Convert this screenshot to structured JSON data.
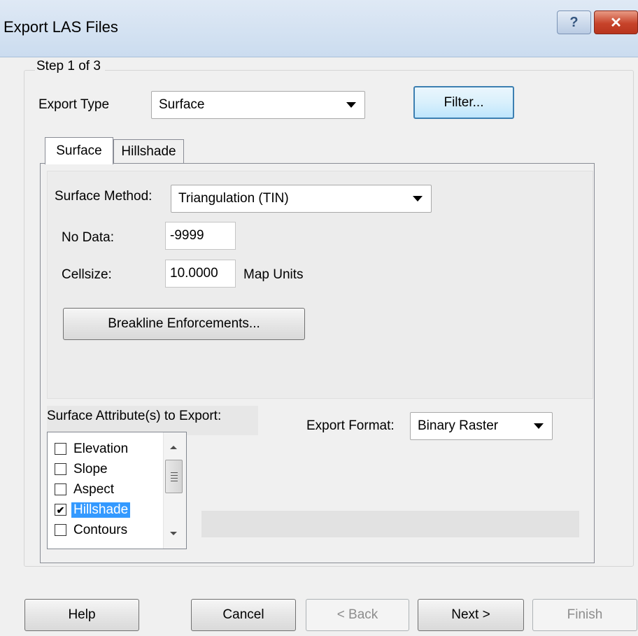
{
  "window": {
    "title": "Export LAS Files",
    "help_glyph": "?",
    "close_glyph": "✕"
  },
  "group": {
    "legend": "Step 1 of 3"
  },
  "export_type": {
    "label": "Export Type",
    "value": "Surface",
    "filter_button": "Filter..."
  },
  "tabs": [
    {
      "label": "Surface",
      "active": true
    },
    {
      "label": "Hillshade",
      "active": false
    }
  ],
  "surface": {
    "method_label": "Surface Method:",
    "method_value": "Triangulation (TIN)",
    "nodata_label": "No Data:",
    "nodata_value": "-9999",
    "cellsize_label": "Cellsize:",
    "cellsize_value": "10.0000",
    "cellsize_units": "Map Units",
    "breakline_button": "Breakline Enforcements..."
  },
  "attributes": {
    "label": "Surface Attribute(s) to Export:",
    "items": [
      {
        "label": "Elevation",
        "checked": false,
        "selected": false
      },
      {
        "label": "Slope",
        "checked": false,
        "selected": false
      },
      {
        "label": "Aspect",
        "checked": false,
        "selected": false
      },
      {
        "label": "Hillshade",
        "checked": true,
        "selected": true
      },
      {
        "label": "Contours",
        "checked": false,
        "selected": false
      }
    ],
    "check_glyph": "✔"
  },
  "export_format": {
    "label": "Export Format:",
    "value": "Binary Raster"
  },
  "footer": {
    "help": "Help",
    "cancel": "Cancel",
    "back": "< Back",
    "next": "Next >",
    "finish": "Finish"
  }
}
